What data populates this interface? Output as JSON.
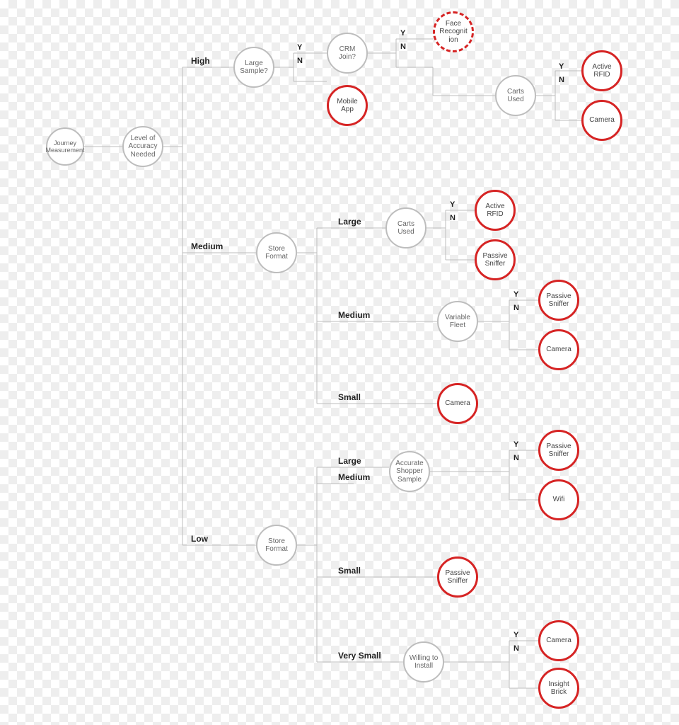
{
  "nodes": {
    "root": "Journey Measurement",
    "accuracy": "Level of Accuracy Needed",
    "large_sample": "Large Sample?",
    "crm_join": "CRM Join?",
    "face_recog": "Face Recognit ion",
    "mobile_app": "Mobile App",
    "carts_used_high": "Carts Used",
    "active_rfid_high": "Active RFID",
    "camera_high": "Camera",
    "store_format_med": "Store Format",
    "carts_used_med": "Carts Used",
    "active_rfid_med": "Active RFID",
    "passive_sniffer_med": "Passive Sniffer",
    "variable_fleet": "Variable Fleet",
    "passive_sniffer_vf": "Passive Sniffer",
    "camera_vf": "Camera",
    "camera_small": "Camera",
    "store_format_low": "Store Format",
    "acc_sample": "Accurate Shopper Sample",
    "passive_sniffer_acc": "Passive Sniffer",
    "wifi": "Wifi",
    "passive_sniffer_small": "Passive Sniffer",
    "willing_install": "Willing to Install",
    "camera_vs": "Camera",
    "insight_brick": "Insight Brick"
  },
  "branch_labels": {
    "high": "High",
    "medium": "Medium",
    "low": "Low",
    "large": "Large",
    "medium2": "Medium",
    "small": "Small",
    "large2": "Large",
    "medium3": "Medium",
    "small2": "Small",
    "vsmall": "Very Small"
  },
  "yn": {
    "y": "Y",
    "n": "N"
  }
}
